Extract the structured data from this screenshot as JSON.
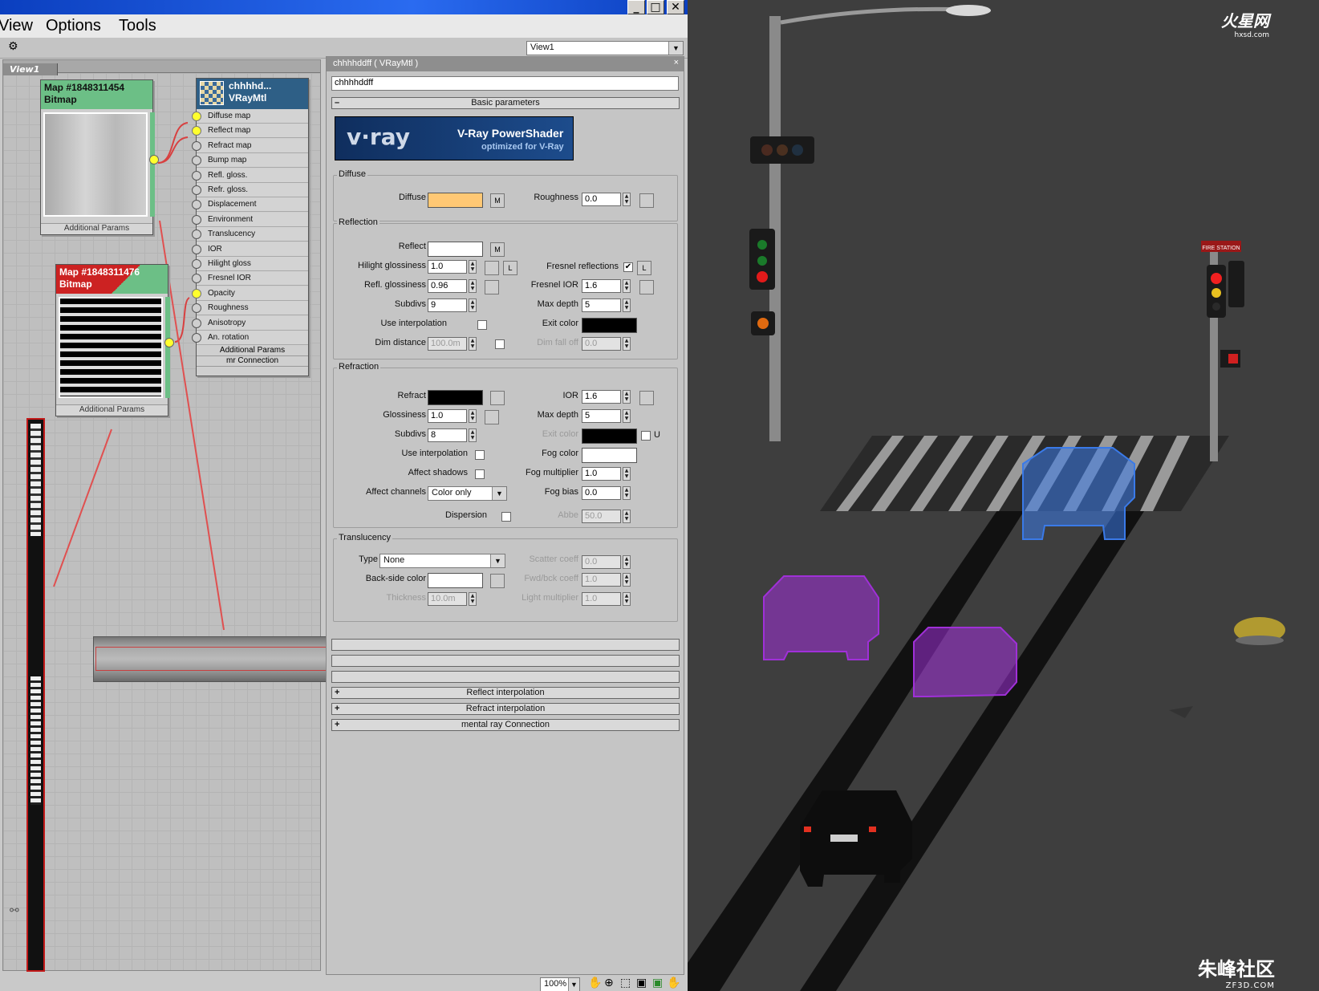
{
  "menubar": {
    "items": [
      "View",
      "Options",
      "Tools"
    ]
  },
  "toolbar": {
    "view_select": "View1"
  },
  "view": {
    "tab": "View1"
  },
  "nodes": {
    "bitmap1": {
      "line1": "Map #1848311454",
      "line2": "Bitmap",
      "footer": "Additional Params"
    },
    "bitmap2": {
      "line1": "Map #1848311476",
      "line2": "Bitmap",
      "footer": "Additional Params"
    },
    "vraymtl": {
      "line1": "chhhhd...",
      "line2": "VRayMtl",
      "slots": [
        "Diffuse map",
        "Reflect map",
        "Refract map",
        "Bump map",
        "Refl. gloss.",
        "Refr. gloss.",
        "Displacement",
        "Environment",
        "Translucency",
        "IOR",
        "Hilight gloss",
        "Fresnel IOR",
        "Opacity",
        "Roughness",
        "Anisotropy",
        "An. rotation"
      ],
      "footer1": "Additional Params",
      "footer2": "mr Connection"
    }
  },
  "material": {
    "title": "chhhhddff ( VRayMtl )",
    "name": "chhhhddff",
    "basic_params": "Basic parameters",
    "banner": {
      "logo": "v·ray",
      "line1": "V-Ray PowerShader",
      "line2": "optimized for V-Ray"
    },
    "diffuse": {
      "group": "Diffuse",
      "label": "Diffuse",
      "m": "M",
      "roughness_label": "Roughness",
      "roughness": "0.0",
      "color": "#ffc874"
    },
    "reflection": {
      "group": "Reflection",
      "reflect_label": "Reflect",
      "m": "M",
      "hilight_label": "Hilight glossiness",
      "hilight": "1.0",
      "l": "L",
      "fresnel_label": "Fresnel reflections",
      "refl_gloss_label": "Refl. glossiness",
      "refl_gloss": "0.96",
      "fresnel_ior_label": "Fresnel IOR",
      "fresnel_ior": "1.6",
      "subdivs_label": "Subdivs",
      "subdivs": "9",
      "max_depth_label": "Max depth",
      "max_depth": "5",
      "use_interp_label": "Use interpolation",
      "exit_color_label": "Exit color",
      "dim_distance_label": "Dim distance",
      "dim_distance": "100.0m",
      "dim_falloff_label": "Dim fall off",
      "dim_falloff": "0.0"
    },
    "refraction": {
      "group": "Refraction",
      "refract_label": "Refract",
      "ior_label": "IOR",
      "ior": "1.6",
      "gloss_label": "Glossiness",
      "gloss": "1.0",
      "max_depth_label": "Max depth",
      "max_depth": "5",
      "subdivs_label": "Subdivs",
      "subdivs": "8",
      "exit_color_label": "Exit color",
      "u": "U",
      "use_interp_label": "Use interpolation",
      "fog_color_label": "Fog color",
      "affect_shadows_label": "Affect shadows",
      "fog_mult_label": "Fog multiplier",
      "fog_mult": "1.0",
      "affect_channels_label": "Affect channels",
      "affect_channels": "Color only",
      "fog_bias_label": "Fog bias",
      "fog_bias": "0.0",
      "dispersion_label": "Dispersion",
      "abbe_label": "Abbe",
      "abbe": "50.0"
    },
    "translucency": {
      "group": "Translucency",
      "type_label": "Type",
      "type": "None",
      "scatter_label": "Scatter coeff",
      "scatter": "0.0",
      "backside_label": "Back-side color",
      "fwdbck_label": "Fwd/bck coeff",
      "fwdbck": "1.0",
      "thickness_label": "Thickness",
      "thickness": "10.0m",
      "light_mult_label": "Light multiplier",
      "light_mult": "1.0"
    },
    "rollouts": [
      "Reflect interpolation",
      "Refract interpolation",
      "mental ray Connection"
    ]
  },
  "statusbar": {
    "zoom": "100%"
  },
  "watermarks": {
    "top": "火星网",
    "top_sub": "hxsd.com",
    "bottom": "朱峰社区",
    "bottom_sub": "ZF3D.COM"
  },
  "scene": {
    "sign_text": "FIRE STATION"
  }
}
